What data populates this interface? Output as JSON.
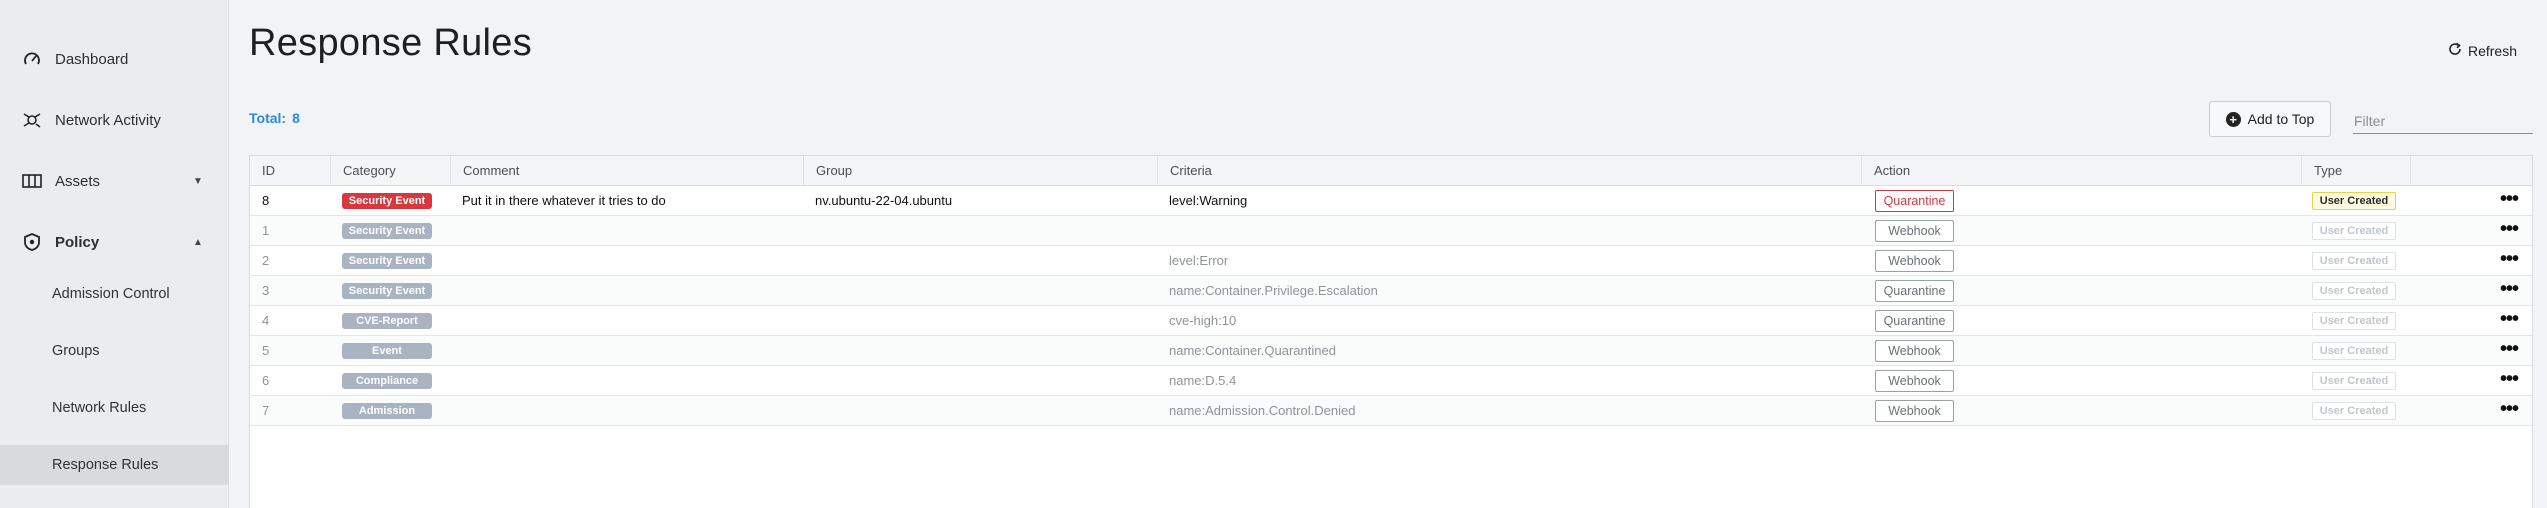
{
  "sidebar": {
    "items": [
      {
        "label": "Dashboard",
        "icon": "speedometer-icon"
      },
      {
        "label": "Network Activity",
        "icon": "network-icon"
      },
      {
        "label": "Assets",
        "icon": "assets-icon",
        "caret": "▼"
      },
      {
        "label": "Policy",
        "icon": "shield-icon",
        "caret": "▲"
      }
    ],
    "sub_items": [
      {
        "label": "Admission Control"
      },
      {
        "label": "Groups"
      },
      {
        "label": "Network Rules"
      },
      {
        "label": "Response Rules",
        "active": true
      }
    ]
  },
  "header": {
    "title": "Response Rules",
    "refresh_label": "Refresh"
  },
  "toolbar": {
    "total_label": "Total:",
    "total_count": "8",
    "add_label": "Add to Top",
    "filter_placeholder": "Filter"
  },
  "table": {
    "columns": [
      "ID",
      "Category",
      "Comment",
      "Group",
      "Criteria",
      "Action",
      "Type"
    ],
    "rows": [
      {
        "id": "8",
        "category": "Security Event",
        "category_color": "#d9363e",
        "comment": "Put it in there whatever it tries to do",
        "group": "nv.ubuntu-22-04.ubuntu",
        "criteria": "level:Warning",
        "action": "Quarantine",
        "type": "User Created",
        "enabled": true
      },
      {
        "id": "1",
        "category": "Security Event",
        "category_color": "#a9b3c1",
        "comment": "",
        "group": "",
        "criteria": "",
        "action": "Webhook",
        "type": "User Created",
        "enabled": false
      },
      {
        "id": "2",
        "category": "Security Event",
        "category_color": "#a9b3c1",
        "comment": "",
        "group": "",
        "criteria": "level:Error",
        "action": "Webhook",
        "type": "User Created",
        "enabled": false
      },
      {
        "id": "3",
        "category": "Security Event",
        "category_color": "#a9b3c1",
        "comment": "",
        "group": "",
        "criteria": "name:Container.Privilege.Escalation",
        "action": "Quarantine",
        "type": "User Created",
        "enabled": false
      },
      {
        "id": "4",
        "category": "CVE-Report",
        "category_color": "#a9b3c1",
        "comment": "",
        "group": "",
        "criteria": "cve-high:10",
        "action": "Quarantine",
        "type": "User Created",
        "enabled": false
      },
      {
        "id": "5",
        "category": "Event",
        "category_color": "#a9b3c1",
        "comment": "",
        "group": "",
        "criteria": "name:Container.Quarantined",
        "action": "Webhook",
        "type": "User Created",
        "enabled": false
      },
      {
        "id": "6",
        "category": "Compliance",
        "category_color": "#a9b3c1",
        "comment": "",
        "group": "",
        "criteria": "name:D.5.4",
        "action": "Webhook",
        "type": "User Created",
        "enabled": false
      },
      {
        "id": "7",
        "category": "Admission",
        "category_color": "#a9b3c1",
        "comment": "",
        "group": "",
        "criteria": "name:Admission.Control.Denied",
        "action": "Webhook",
        "type": "User Created",
        "enabled": false
      }
    ],
    "row_menu_glyph": "•••"
  }
}
